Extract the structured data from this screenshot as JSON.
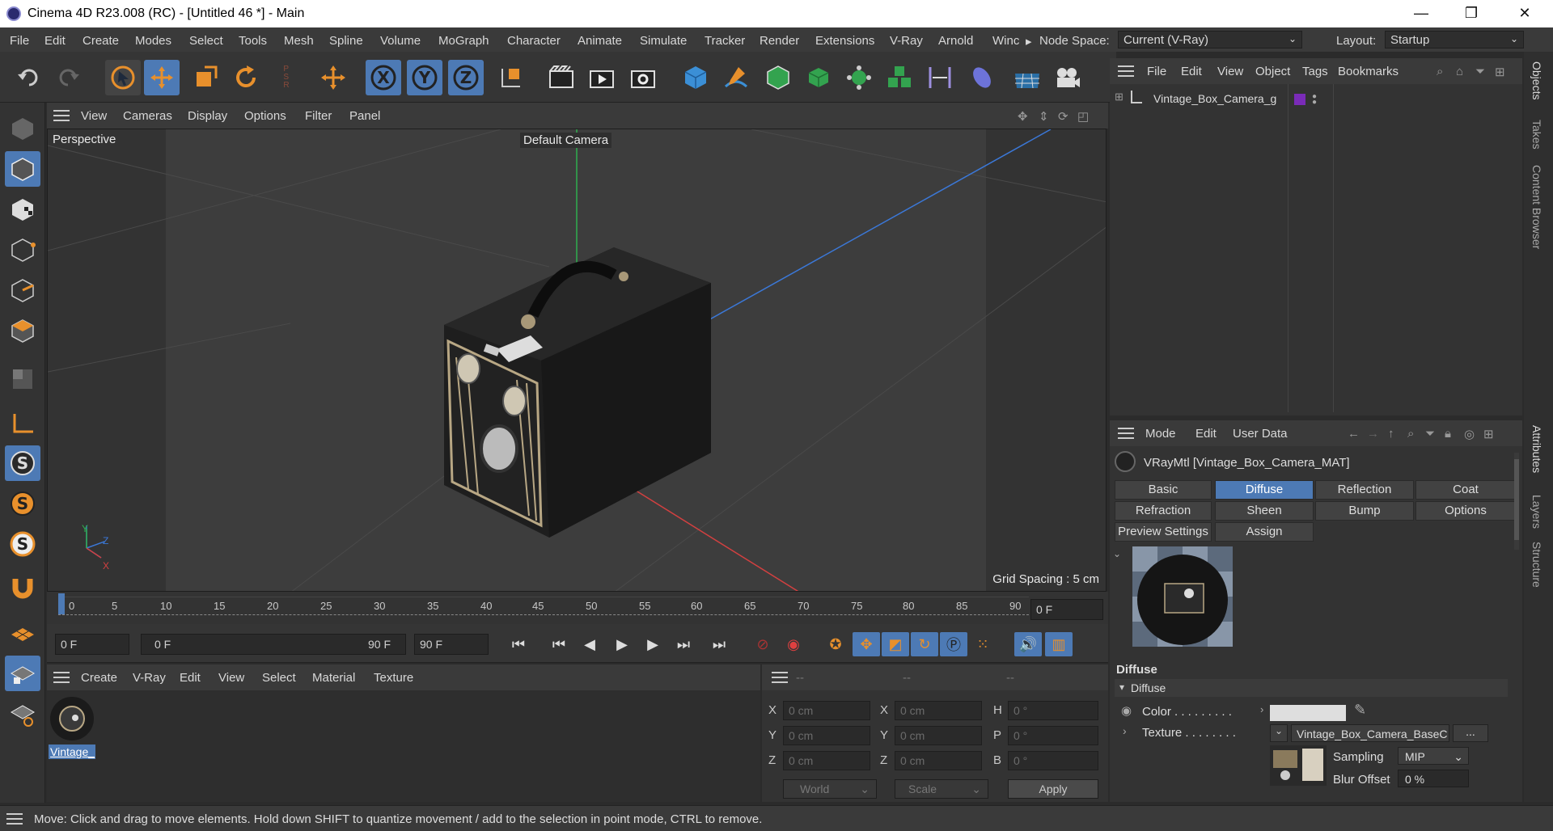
{
  "window": {
    "title": "Cinema 4D R23.008 (RC) - [Untitled 46 *] - Main",
    "minimize": "—",
    "maximize": "❐",
    "close": "✕"
  },
  "menubar": {
    "items": [
      "File",
      "Edit",
      "Create",
      "Modes",
      "Select",
      "Tools",
      "Mesh",
      "Spline",
      "Volume",
      "MoGraph",
      "Character",
      "Animate",
      "Simulate",
      "Tracker",
      "Render",
      "Extensions",
      "V-Ray",
      "Arnold",
      "Winc"
    ],
    "overflow_arrow": "▸",
    "node_space_label": "Node Space:",
    "node_space_value": "Current (V-Ray)",
    "layout_label": "Layout:",
    "layout_value": "Startup"
  },
  "viewport": {
    "menu": [
      "View",
      "Cameras",
      "Display",
      "Options",
      "Filter",
      "Panel"
    ],
    "label": "Perspective",
    "camera": "Default Camera",
    "grid_spacing": "Grid Spacing : 5 cm",
    "axis_x": "X",
    "axis_y": "Y",
    "axis_z": "Z"
  },
  "timeline": {
    "ticks": [
      "0",
      "5",
      "10",
      "15",
      "20",
      "25",
      "30",
      "35",
      "40",
      "45",
      "50",
      "55",
      "60",
      "65",
      "70",
      "75",
      "80",
      "85",
      "90"
    ],
    "current_frame": "0 F",
    "start_field": "0 F",
    "range_start": "0 F",
    "range_end": "90 F",
    "end_field": "90 F"
  },
  "material_manager": {
    "menu": [
      "Create",
      "V-Ray",
      "Edit",
      "View",
      "Select",
      "Material",
      "Texture"
    ],
    "material_name": "Vintage_"
  },
  "coordinates": {
    "headers": [
      "--",
      "--",
      "--"
    ],
    "rows": [
      {
        "l1": "X",
        "v1": "0 cm",
        "l2": "X",
        "v2": "0 cm",
        "l3": "H",
        "v3": "0 °"
      },
      {
        "l1": "Y",
        "v1": "0 cm",
        "l2": "Y",
        "v2": "0 cm",
        "l3": "P",
        "v3": "0 °"
      },
      {
        "l1": "Z",
        "v1": "0 cm",
        "l2": "Z",
        "v2": "0 cm",
        "l3": "B",
        "v3": "0 °"
      }
    ],
    "space": "World",
    "scale": "Scale",
    "apply": "Apply"
  },
  "objects": {
    "menu": [
      "File",
      "Edit",
      "View",
      "Object",
      "Tags",
      "Bookmarks"
    ],
    "item": "Vintage_Box_Camera_g",
    "tag_color": "#7a2bb8"
  },
  "attributes": {
    "menu": [
      "Mode",
      "Edit",
      "User Data"
    ],
    "material_title": "VRayMtl [Vintage_Box_Camera_MAT]",
    "tabs_row1": [
      "Basic",
      "Diffuse",
      "Reflection",
      "Coat"
    ],
    "tabs_row2": [
      "Refraction",
      "Sheen",
      "Bump",
      "Options"
    ],
    "tabs_row3": [
      "Preview Settings",
      "Assign"
    ],
    "section": "Diffuse",
    "group": "Diffuse",
    "color_label": "Color . . . . . . . . .",
    "texture_label": "Texture . . . . . . . .",
    "texture_value": "Vintage_Box_Camera_BaseC",
    "more": "...",
    "sampling_label": "Sampling",
    "sampling_value": "MIP",
    "blur_label": "Blur Offset",
    "blur_value": "0 %"
  },
  "right_tabs": [
    "Objects",
    "Takes",
    "Content Browser",
    "Attributes",
    "Layers",
    "Structure"
  ],
  "status": "Move: Click and drag to move elements. Hold down SHIFT to quantize movement / add to the selection in point mode, CTRL to remove.",
  "colors": {
    "accent": "#4d7ab5",
    "panel": "#333333",
    "menu": "#3a3a3a"
  }
}
